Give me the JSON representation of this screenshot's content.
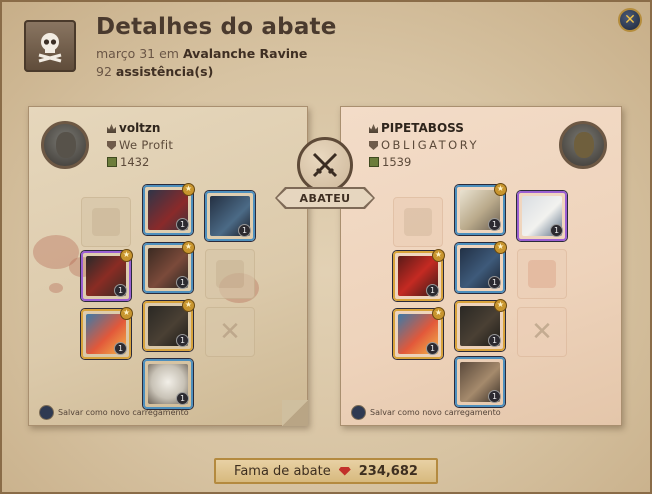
{
  "header": {
    "title": "Detalhes do abate",
    "date": "março 31",
    "em_word": "em",
    "location": "Avalanche Ravine",
    "assist_count": "92",
    "assist_label": "assistência(s)"
  },
  "killer": {
    "name": "voltzn",
    "guild": "We Profit",
    "item_power": "1432",
    "save_label": "Salvar como novo carregamento"
  },
  "victim": {
    "name": "PIPETABOSS",
    "guild": "OBLIGATORY",
    "item_power": "1539",
    "save_label": "Salvar como novo carregamento"
  },
  "verdict": "ABATEU",
  "fame": {
    "label": "Fama de abate",
    "value": "234,682"
  },
  "icons": [
    "skull-crossbones-icon",
    "close-icon",
    "crossed-swords-icon",
    "fork-knife-icon",
    "fame-gem-icon"
  ],
  "colors": {
    "accent": "#d8a33b",
    "title": "#4a3a2e",
    "blood": "#b3624c"
  }
}
